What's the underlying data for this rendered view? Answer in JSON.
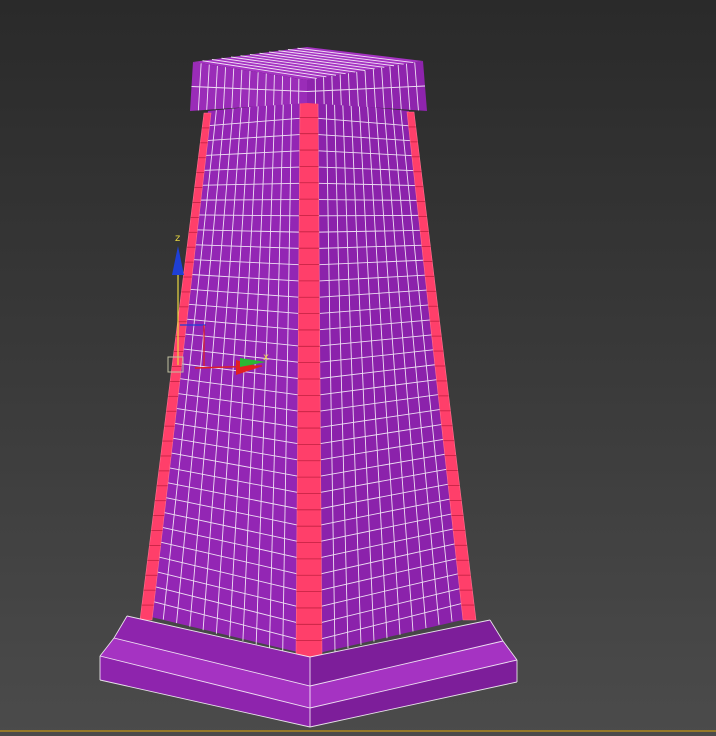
{
  "viewport": {
    "colors": {
      "face": "#9326b4",
      "face_dark": "#7d1e9a",
      "face_light": "#a533c2",
      "edge_selected": "#ff3f6a",
      "wire": "#ffffff",
      "gizmo_z": "#1e3fd6",
      "gizmo_y": "#29b834",
      "gizmo_x": "#e02020",
      "gizmo_plane": "#f0e040",
      "timeline_line": "#b08a20"
    }
  },
  "gizmo": {
    "z_label": "z",
    "x_label": "x"
  }
}
